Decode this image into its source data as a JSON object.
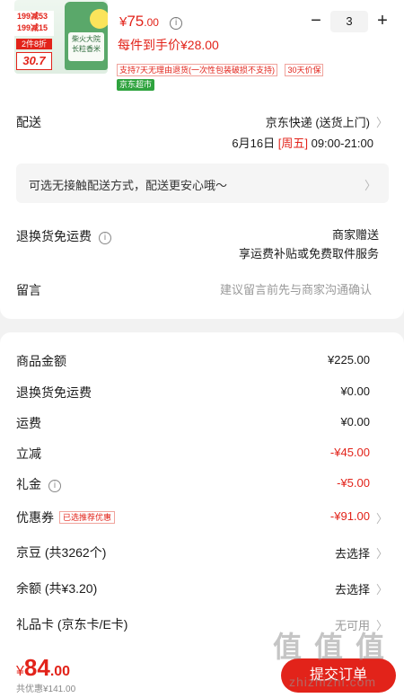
{
  "product": {
    "image_promos": [
      "199减53",
      "199减15",
      "2件8折",
      "30.7"
    ],
    "image_label": [
      "柴火大院",
      "长粒香米"
    ],
    "price_symbol": "¥",
    "price_int": "75",
    "price_dec": ".00",
    "unit_price": "每件到手价¥28.00",
    "tags": [
      "支持7天无理由退货(一次性包装破损不支持)",
      "30天价保"
    ],
    "store_tag": "京东超市",
    "quantity": "3"
  },
  "delivery": {
    "label": "配送",
    "method": "京东快递 (送货上门)",
    "date": "6月16日",
    "weekday": "[周五]",
    "time": "09:00-21:00"
  },
  "contactless": {
    "text": "可选无接触配送方式，配送更安心哦～"
  },
  "return_shipping": {
    "label": "退换货免运费",
    "value": "商家赠送",
    "sub": "享运费补贴或免费取件服务"
  },
  "message": {
    "label": "留言",
    "placeholder": "建议留言前先与商家沟通确认"
  },
  "summary": {
    "rows": [
      {
        "label": "商品金额",
        "value": "¥225.00"
      },
      {
        "label": "退换货免运费",
        "value": "¥0.00"
      },
      {
        "label": "运费",
        "value": "¥0.00"
      },
      {
        "label": "立减",
        "value": "-¥45.00"
      },
      {
        "label": "礼金",
        "value": "-¥5.00"
      },
      {
        "label": "优惠券",
        "badge": "已选推荐优惠",
        "value": "-¥91.00"
      },
      {
        "label": "京豆 (共3262个)",
        "value": "去选择"
      },
      {
        "label": "余额 (共¥3.20)",
        "value": "去选择"
      },
      {
        "label": "礼品卡 (京东卡/E卡)",
        "value": "无可用"
      }
    ]
  },
  "footer": {
    "symbol": "¥",
    "total_int": "84",
    "total_dec": ".00",
    "discount": "共优惠¥141.00",
    "submit": "提交订单"
  },
  "watermark": {
    "glyphs": [
      "值",
      "值",
      "值"
    ],
    "site": "zhizhizhi.com"
  },
  "colors": {
    "accent": "#e2231a",
    "store_tag": "#2fa33e"
  }
}
